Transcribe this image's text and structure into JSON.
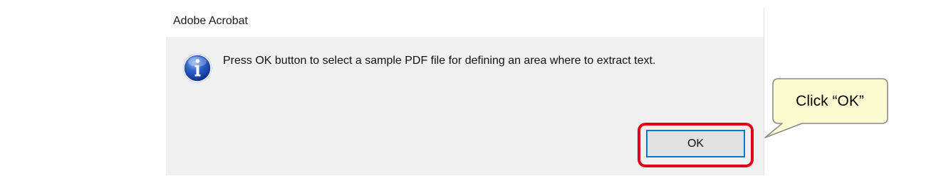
{
  "dialog": {
    "title": "Adobe Acrobat",
    "icon": "info-icon",
    "message": "Press OK button to select a sample PDF file for defining an area where to extract text.",
    "ok_label": "OK"
  },
  "annotation": {
    "callout_text": "Click “OK”",
    "highlight_color": "#e3001b",
    "callout_fill": "#fdfcd0"
  },
  "colors": {
    "dialog_background": "#f0f0f0",
    "button_focus_border": "#0078d7",
    "info_icon_blue": "#1f4fb4"
  }
}
